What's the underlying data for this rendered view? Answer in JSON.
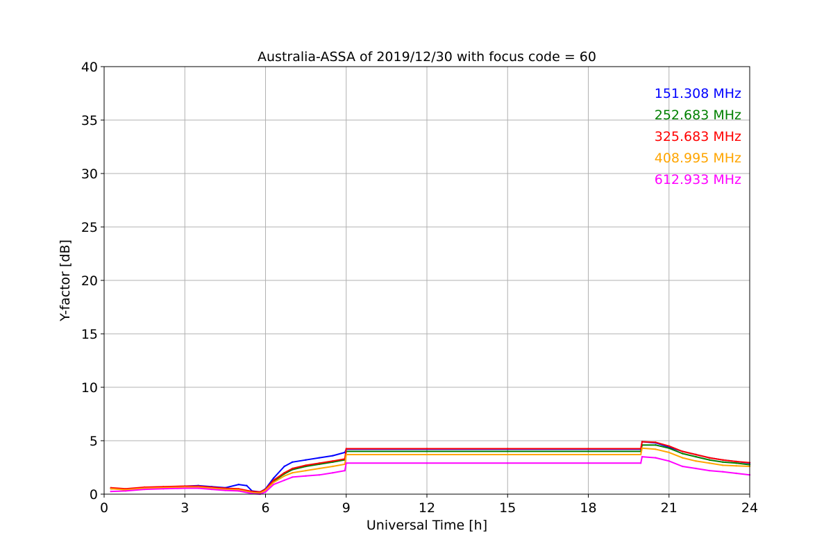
{
  "chart_data": {
    "type": "line",
    "title": "Australia-ASSA of 2019/12/30 with focus code = 60",
    "xlabel": "Universal Time [h]",
    "ylabel": "Y-factor [dB]",
    "xlim": [
      0,
      24
    ],
    "ylim": [
      0,
      40
    ],
    "xticks": [
      0,
      3,
      6,
      9,
      12,
      15,
      18,
      21,
      24
    ],
    "yticks": [
      0,
      5,
      10,
      15,
      20,
      25,
      30,
      35,
      40
    ],
    "grid": true,
    "legend_position": "top-right",
    "series": [
      {
        "name": "151.308 MHz",
        "color": "#0000ff",
        "x": [
          0.25,
          0.8,
          1.5,
          2.2,
          3.0,
          3.5,
          4.0,
          4.5,
          5.0,
          5.3,
          5.5,
          5.8,
          6.0,
          6.3,
          6.7,
          7.0,
          7.5,
          8.0,
          8.5,
          8.95,
          9.0,
          12.0,
          15.0,
          18.0,
          19.95,
          20.0,
          20.5,
          21.0,
          21.5,
          22.0,
          22.5,
          23.0,
          23.5,
          24.0
        ],
        "values": [
          0.5,
          0.45,
          0.6,
          0.65,
          0.75,
          0.8,
          0.7,
          0.6,
          0.9,
          0.8,
          0.3,
          0.2,
          0.5,
          1.5,
          2.6,
          3.0,
          3.2,
          3.4,
          3.6,
          3.9,
          4.2,
          4.2,
          4.2,
          4.2,
          4.2,
          4.9,
          4.8,
          4.4,
          4.0,
          3.7,
          3.4,
          3.2,
          3.05,
          2.9
        ]
      },
      {
        "name": "252.683 MHz",
        "color": "#008000",
        "x": [
          0.25,
          0.8,
          1.5,
          2.2,
          3.0,
          3.5,
          4.0,
          4.5,
          5.0,
          5.5,
          5.8,
          6.0,
          6.3,
          6.7,
          7.0,
          7.5,
          8.0,
          8.5,
          8.95,
          9.0,
          12.0,
          15.0,
          18.0,
          19.95,
          20.0,
          20.5,
          21.0,
          21.5,
          22.0,
          22.5,
          23.0,
          23.5,
          24.0
        ],
        "values": [
          0.55,
          0.45,
          0.6,
          0.65,
          0.7,
          0.7,
          0.6,
          0.5,
          0.45,
          0.2,
          0.15,
          0.4,
          1.2,
          1.9,
          2.3,
          2.6,
          2.8,
          3.0,
          3.2,
          4.0,
          4.0,
          4.0,
          4.0,
          4.0,
          4.6,
          4.6,
          4.3,
          3.8,
          3.5,
          3.2,
          3.0,
          2.9,
          2.75
        ]
      },
      {
        "name": "325.683 MHz",
        "color": "#ff0000",
        "x": [
          0.25,
          0.8,
          1.5,
          2.2,
          3.0,
          3.5,
          4.0,
          4.5,
          5.0,
          5.5,
          5.8,
          6.0,
          6.3,
          6.7,
          7.0,
          7.5,
          8.0,
          8.5,
          8.95,
          9.0,
          12.0,
          15.0,
          18.0,
          19.95,
          20.0,
          20.5,
          21.0,
          21.5,
          22.0,
          22.5,
          23.0,
          23.5,
          24.0
        ],
        "values": [
          0.6,
          0.5,
          0.65,
          0.7,
          0.75,
          0.75,
          0.65,
          0.55,
          0.5,
          0.25,
          0.2,
          0.45,
          1.3,
          2.0,
          2.4,
          2.7,
          2.9,
          3.1,
          3.3,
          4.25,
          4.25,
          4.25,
          4.25,
          4.25,
          4.9,
          4.85,
          4.5,
          4.0,
          3.7,
          3.4,
          3.2,
          3.05,
          2.95
        ]
      },
      {
        "name": "408.995 MHz",
        "color": "#ffa500",
        "x": [
          0.25,
          0.8,
          1.5,
          2.2,
          3.0,
          3.5,
          4.0,
          4.5,
          5.0,
          5.5,
          5.8,
          6.0,
          6.3,
          6.7,
          7.0,
          7.5,
          8.0,
          8.5,
          8.95,
          9.0,
          12.0,
          15.0,
          18.0,
          19.95,
          20.0,
          20.5,
          21.0,
          21.5,
          22.0,
          22.5,
          23.0,
          23.5,
          24.0
        ],
        "values": [
          0.5,
          0.4,
          0.55,
          0.6,
          0.65,
          0.65,
          0.55,
          0.45,
          0.4,
          0.15,
          0.1,
          0.35,
          1.1,
          1.7,
          2.0,
          2.2,
          2.4,
          2.6,
          2.8,
          3.7,
          3.7,
          3.7,
          3.7,
          3.7,
          4.3,
          4.2,
          3.9,
          3.4,
          3.1,
          2.9,
          2.7,
          2.65,
          2.6
        ]
      },
      {
        "name": "612.933 MHz",
        "color": "#ff00ff",
        "x": [
          0.25,
          0.8,
          1.5,
          2.2,
          3.0,
          3.5,
          4.0,
          4.5,
          5.0,
          5.5,
          5.8,
          6.0,
          6.3,
          6.7,
          7.0,
          7.5,
          8.0,
          8.5,
          8.95,
          9.0,
          12.0,
          15.0,
          18.0,
          19.95,
          20.0,
          20.5,
          21.0,
          21.5,
          22.0,
          22.5,
          23.0,
          23.5,
          24.0
        ],
        "values": [
          0.25,
          0.3,
          0.45,
          0.5,
          0.55,
          0.55,
          0.45,
          0.35,
          0.3,
          0.05,
          0.0,
          0.2,
          0.9,
          1.3,
          1.6,
          1.7,
          1.8,
          2.0,
          2.2,
          2.9,
          2.9,
          2.9,
          2.9,
          2.9,
          3.5,
          3.4,
          3.1,
          2.6,
          2.4,
          2.2,
          2.1,
          1.95,
          1.8
        ]
      }
    ]
  }
}
